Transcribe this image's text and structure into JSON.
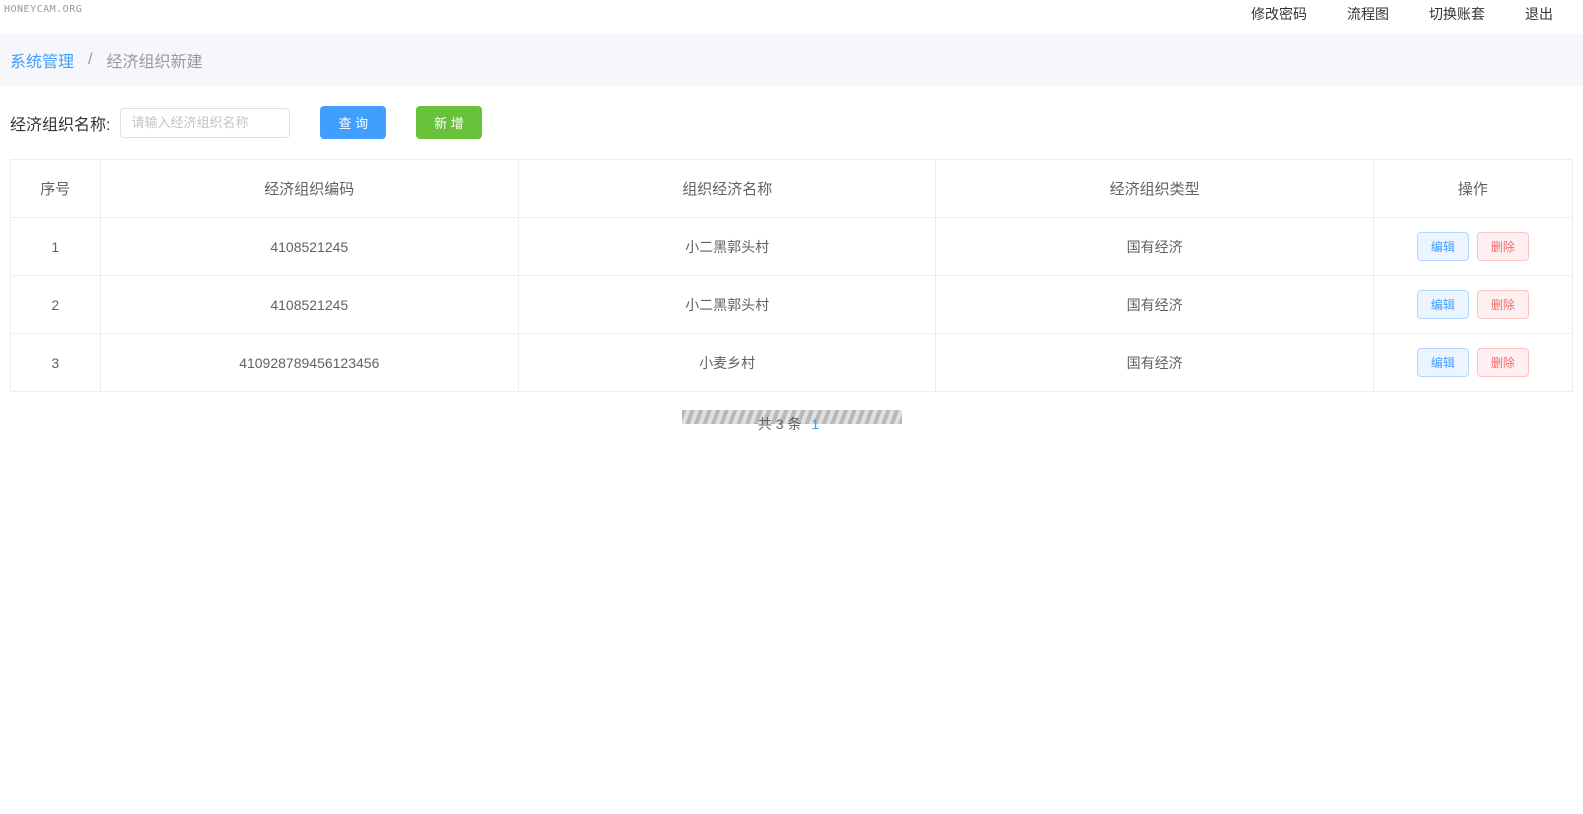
{
  "watermark": "HONEYCAM.ORG",
  "topnav": {
    "items": [
      {
        "label": "修改密码"
      },
      {
        "label": "流程图"
      },
      {
        "label": "切换账套"
      },
      {
        "label": "退出"
      }
    ]
  },
  "breadcrumb": {
    "root": "系统管理",
    "sep": "/",
    "current": "经济组织新建"
  },
  "search": {
    "label": "经济组织名称:",
    "placeholder": "请输入经济组织名称",
    "value": "",
    "query_btn": "查 询",
    "add_btn": "新 增"
  },
  "table": {
    "headers": {
      "idx": "序号",
      "code": "经济组织编码",
      "name": "组织经济名称",
      "type": "经济组织类型",
      "action": "操作"
    },
    "edit_label": "编辑",
    "delete_label": "删除",
    "rows": [
      {
        "idx": "1",
        "code": "4108521245",
        "name": "小二黑郭头村",
        "type": "国有经济"
      },
      {
        "idx": "2",
        "code": "4108521245",
        "name": "小二黑郭头村",
        "type": "国有经济"
      },
      {
        "idx": "3",
        "code": "410928789456123456",
        "name": "小麦乡村",
        "type": "国有经济"
      }
    ]
  },
  "pager": {
    "prefix": "共",
    "count": "3",
    "suffix": "条",
    "page_num": "1"
  }
}
